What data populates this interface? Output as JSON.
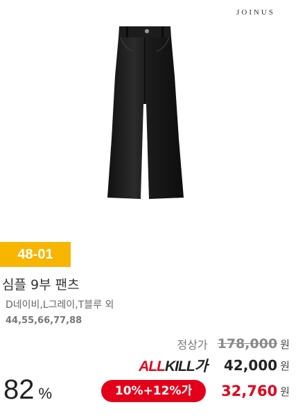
{
  "brand": "JOINUS",
  "product": {
    "code": "48-01",
    "title": "심플 9부 팬츠",
    "colors": "D네이비,L그레이,T블루 외",
    "sizes": "44,55,66,77,88"
  },
  "pricing": {
    "regular_label": "정상가",
    "regular_price": "178,000",
    "currency": "원",
    "allkill_all": "ALL",
    "allkill_kill": "KILL가",
    "allkill_price": "42,000",
    "discount_label": "10%+12%가",
    "final_price": "32,760",
    "rate": "82",
    "rate_unit": "%"
  },
  "colors": {
    "badge": "#f7b500",
    "accent_red": "#e4001b"
  }
}
